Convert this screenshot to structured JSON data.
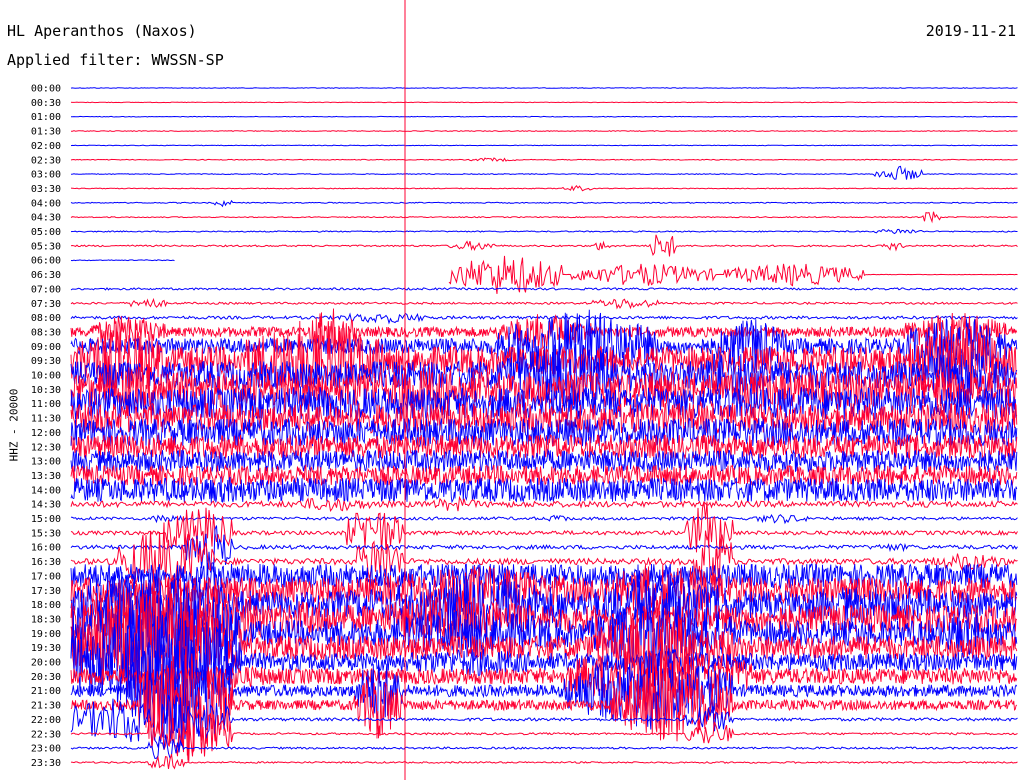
{
  "header": {
    "station": "HL Aperanthos (Naxos)",
    "filter": "Applied filter: WWSSN-SP",
    "date": "2019-11-21"
  },
  "chart_data": {
    "type": "helicorder",
    "ylabel": "HHZ - 20000",
    "line_colors": [
      "#0000ff",
      "#ff0033"
    ],
    "marker_color": "#ff0033",
    "rows": [
      {
        "label": "00:00",
        "amp": 0.3,
        "bursts": []
      },
      {
        "label": "00:30",
        "amp": 0.3,
        "bursts": []
      },
      {
        "label": "01:00",
        "amp": 0.3,
        "bursts": []
      },
      {
        "label": "01:30",
        "amp": 0.4,
        "bursts": []
      },
      {
        "label": "02:00",
        "amp": 0.3,
        "bursts": []
      },
      {
        "label": "02:30",
        "amp": 0.4,
        "bursts": [
          [
            0.42,
            0.47,
            2
          ]
        ]
      },
      {
        "label": "03:00",
        "amp": 0.4,
        "bursts": [
          [
            0.85,
            0.9,
            8
          ]
        ]
      },
      {
        "label": "03:30",
        "amp": 0.4,
        "bursts": [
          [
            0.52,
            0.55,
            3
          ]
        ]
      },
      {
        "label": "04:00",
        "amp": 0.5,
        "bursts": [
          [
            0.15,
            0.17,
            4
          ]
        ]
      },
      {
        "label": "04:30",
        "amp": 0.5,
        "bursts": [
          [
            0.9,
            0.92,
            8
          ]
        ]
      },
      {
        "label": "05:00",
        "amp": 0.6,
        "bursts": [
          [
            0.85,
            0.9,
            3
          ]
        ]
      },
      {
        "label": "05:30",
        "amp": 0.8,
        "bursts": [
          [
            0.4,
            0.45,
            5
          ],
          [
            0.55,
            0.57,
            5
          ],
          [
            0.61,
            0.64,
            16
          ],
          [
            0.86,
            0.88,
            5
          ]
        ]
      },
      {
        "label": "06:00",
        "amp": 0.4,
        "bursts": [],
        "end": 0.11
      },
      {
        "label": "06:30",
        "amp": 0.2,
        "bursts": [
          [
            0.4,
            0.52,
            22
          ],
          [
            0.53,
            0.68,
            12
          ],
          [
            0.69,
            0.84,
            12
          ]
        ],
        "start": 0.4
      },
      {
        "label": "07:00",
        "amp": 1.0,
        "bursts": []
      },
      {
        "label": "07:30",
        "amp": 1.0,
        "bursts": [
          [
            0.06,
            0.1,
            6
          ],
          [
            0.55,
            0.62,
            6
          ]
        ]
      },
      {
        "label": "08:00",
        "amp": 1.5,
        "bursts": [
          [
            0.28,
            0.38,
            6
          ]
        ]
      },
      {
        "label": "08:30",
        "amp": 5,
        "bursts": [
          [
            0.02,
            0.1,
            18
          ],
          [
            0.25,
            0.3,
            25
          ],
          [
            0.45,
            0.55,
            20
          ],
          [
            0.88,
            0.99,
            22
          ]
        ]
      },
      {
        "label": "09:00",
        "amp": 8,
        "bursts": [
          [
            0.45,
            0.62,
            40
          ],
          [
            0.68,
            0.76,
            30
          ],
          [
            0.88,
            0.99,
            35
          ]
        ]
      },
      {
        "label": "09:30",
        "amp": 14,
        "bursts": [
          [
            0.0,
            0.1,
            40
          ],
          [
            0.18,
            0.33,
            45
          ],
          [
            0.88,
            0.99,
            40
          ]
        ]
      },
      {
        "label": "10:00",
        "amp": 14,
        "bursts": [
          [
            0.45,
            0.6,
            35
          ],
          [
            0.65,
            0.75,
            30
          ],
          [
            0.9,
            0.99,
            30
          ]
        ]
      },
      {
        "label": "10:30",
        "amp": 18,
        "bursts": [
          [
            0.0,
            0.15,
            25
          ],
          [
            0.3,
            0.45,
            25
          ]
        ]
      },
      {
        "label": "11:00",
        "amp": 16,
        "bursts": [
          [
            0.1,
            0.4,
            18
          ],
          [
            0.7,
            0.85,
            18
          ]
        ]
      },
      {
        "label": "11:30",
        "amp": 15,
        "bursts": [
          [
            0.35,
            0.6,
            16
          ]
        ]
      },
      {
        "label": "12:00",
        "amp": 14,
        "bursts": [
          [
            0.2,
            0.45,
            14
          ]
        ]
      },
      {
        "label": "12:30",
        "amp": 12,
        "bursts": []
      },
      {
        "label": "13:00",
        "amp": 11,
        "bursts": []
      },
      {
        "label": "13:30",
        "amp": 10,
        "bursts": []
      },
      {
        "label": "14:00",
        "amp": 12,
        "bursts": [
          [
            0.0,
            0.3,
            14
          ],
          [
            0.35,
            0.5,
            10
          ],
          [
            0.62,
            0.95,
            10
          ]
        ]
      },
      {
        "label": "14:30",
        "amp": 3,
        "bursts": [
          [
            0.23,
            0.32,
            8
          ],
          [
            0.38,
            0.43,
            8
          ]
        ]
      },
      {
        "label": "15:00",
        "amp": 1.5,
        "bursts": [
          [
            0.08,
            0.12,
            5
          ],
          [
            0.5,
            0.53,
            4
          ],
          [
            0.72,
            0.78,
            5
          ]
        ]
      },
      {
        "label": "15:30",
        "amp": 2,
        "bursts": [
          [
            0.1,
            0.17,
            30
          ],
          [
            0.29,
            0.35,
            30
          ],
          [
            0.65,
            0.7,
            35
          ]
        ]
      },
      {
        "label": "16:00",
        "amp": 2,
        "bursts": [
          [
            0.12,
            0.17,
            30
          ],
          [
            0.84,
            0.9,
            4
          ]
        ]
      },
      {
        "label": "16:30",
        "amp": 3,
        "bursts": [
          [
            0.05,
            0.15,
            40
          ],
          [
            0.3,
            0.35,
            30
          ],
          [
            0.66,
            0.7,
            45
          ],
          [
            0.91,
            0.99,
            10
          ]
        ]
      },
      {
        "label": "17:00",
        "amp": 12,
        "bursts": [
          [
            0.0,
            0.3,
            14
          ],
          [
            0.3,
            0.55,
            10
          ],
          [
            0.7,
            0.82,
            10
          ]
        ]
      },
      {
        "label": "17:30",
        "amp": 13,
        "bursts": [
          [
            0.3,
            0.55,
            25
          ],
          [
            0.55,
            0.7,
            30
          ],
          [
            0.9,
            0.99,
            12
          ]
        ]
      },
      {
        "label": "18:00",
        "amp": 14,
        "bursts": [
          [
            0.0,
            0.16,
            45
          ],
          [
            0.3,
            0.55,
            30
          ],
          [
            0.55,
            0.7,
            35
          ],
          [
            0.7,
            0.99,
            20
          ]
        ]
      },
      {
        "label": "18:30",
        "amp": 14,
        "bursts": [
          [
            0.0,
            0.2,
            45
          ],
          [
            0.2,
            0.3,
            20
          ],
          [
            0.3,
            0.5,
            25
          ]
        ]
      },
      {
        "label": "19:00",
        "amp": 13,
        "bursts": [
          [
            0.0,
            0.18,
            60
          ],
          [
            0.3,
            0.55,
            25
          ],
          [
            0.55,
            0.7,
            40
          ],
          [
            0.9,
            0.99,
            25
          ]
        ]
      },
      {
        "label": "19:30",
        "amp": 12,
        "bursts": [
          [
            0.0,
            0.18,
            60
          ],
          [
            0.55,
            0.7,
            40
          ]
        ]
      },
      {
        "label": "20:00",
        "amp": 9,
        "bursts": [
          [
            0.0,
            0.18,
            60
          ],
          [
            0.3,
            0.55,
            14
          ],
          [
            0.55,
            0.72,
            14
          ]
        ]
      },
      {
        "label": "20:30",
        "amp": 8,
        "bursts": [
          [
            0.1,
            0.25,
            12
          ],
          [
            0.52,
            0.72,
            35
          ],
          [
            0.92,
            0.99,
            8
          ]
        ]
      },
      {
        "label": "21:00",
        "amp": 6,
        "bursts": [
          [
            0.06,
            0.17,
            60
          ],
          [
            0.3,
            0.35,
            35
          ],
          [
            0.52,
            0.7,
            40
          ]
        ]
      },
      {
        "label": "21:30",
        "amp": 5,
        "bursts": [
          [
            0.07,
            0.17,
            60
          ],
          [
            0.3,
            0.35,
            35
          ],
          [
            0.57,
            0.7,
            40
          ]
        ]
      },
      {
        "label": "22:00",
        "amp": 1.5,
        "bursts": [
          [
            0.0,
            0.17,
            30
          ],
          [
            0.65,
            0.7,
            15
          ]
        ]
      },
      {
        "label": "22:30",
        "amp": 1,
        "bursts": [
          [
            0.08,
            0.17,
            30
          ],
          [
            0.65,
            0.7,
            15
          ]
        ]
      },
      {
        "label": "23:00",
        "amp": 1,
        "bursts": [
          [
            0.08,
            0.12,
            15
          ]
        ]
      },
      {
        "label": "23:30",
        "amp": 0.8,
        "bursts": [
          [
            0.08,
            0.12,
            10
          ]
        ]
      }
    ]
  }
}
